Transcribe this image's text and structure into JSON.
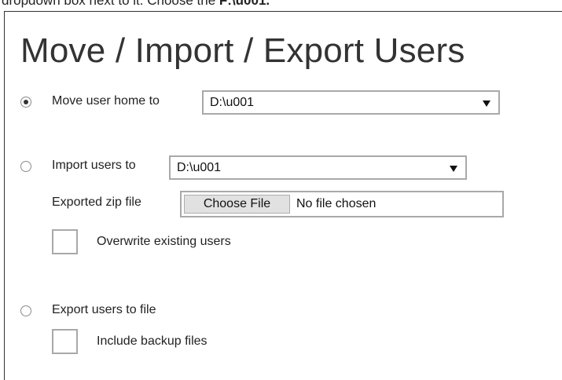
{
  "caption": {
    "text_before": "dropdown box next to it. Choose the ",
    "text_bold": "F:\\u001."
  },
  "title": "Move / Import / Export Users",
  "move": {
    "label": "Move user home to",
    "selected": true,
    "dropdown_value": "D:\\u001"
  },
  "import": {
    "label": "Import users to",
    "selected": false,
    "dropdown_value": "D:\\u001",
    "zip_label": "Exported zip file",
    "choose_file_label": "Choose File",
    "file_status": "No file chosen",
    "overwrite_label": "Overwrite existing users",
    "overwrite_checked": false
  },
  "export": {
    "label": "Export users to file",
    "selected": false,
    "include_backup_label": "Include backup files",
    "include_backup_checked": false
  }
}
